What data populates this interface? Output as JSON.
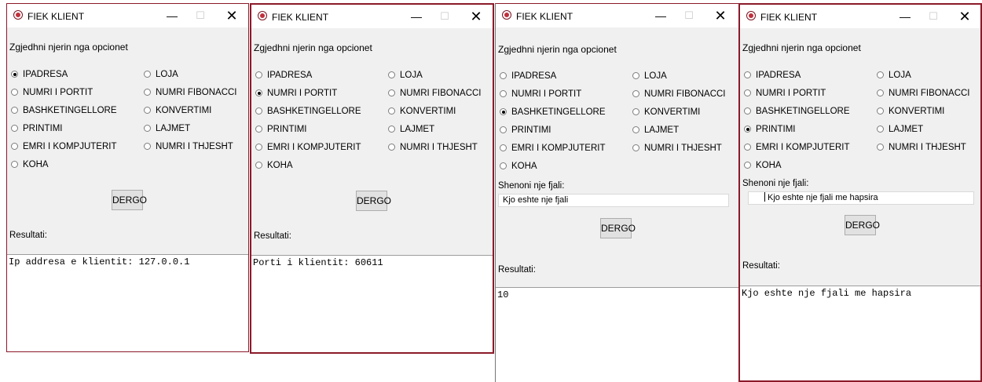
{
  "app_title": "FIEK KLIENT",
  "prompt": "Zgjedhni njerin nga opcionet",
  "options_left": [
    "IPADRESA",
    "NUMRI I PORTIT",
    "BASHKETINGELLORE",
    "PRINTIMI",
    "EMRI I KOMPJUTERIT",
    "KOHA"
  ],
  "options_right": [
    "LOJA",
    "NUMRI FIBONACCI",
    "KONVERTIMI",
    "LAJMET",
    "NUMRI I THJESHT"
  ],
  "send_label": "DERGO",
  "result_label": "Resultati:",
  "input_label": "Shenoni nje fjali:",
  "windows": [
    {
      "selected": "IPADRESA",
      "input_value": "",
      "result": "Ip addresa e klientit: 127.0.0.1"
    },
    {
      "selected": "NUMRI I PORTIT",
      "input_value": "",
      "result": "Porti i klientit: 60611"
    },
    {
      "selected": "BASHKETINGELLORE",
      "input_value": "Kjo eshte nje fjali",
      "result": "10"
    },
    {
      "selected": "PRINTIMI",
      "input_value": "Kjo eshte nje fjali me hapsira",
      "result": "Kjo eshte nje fjali me hapsira"
    }
  ]
}
